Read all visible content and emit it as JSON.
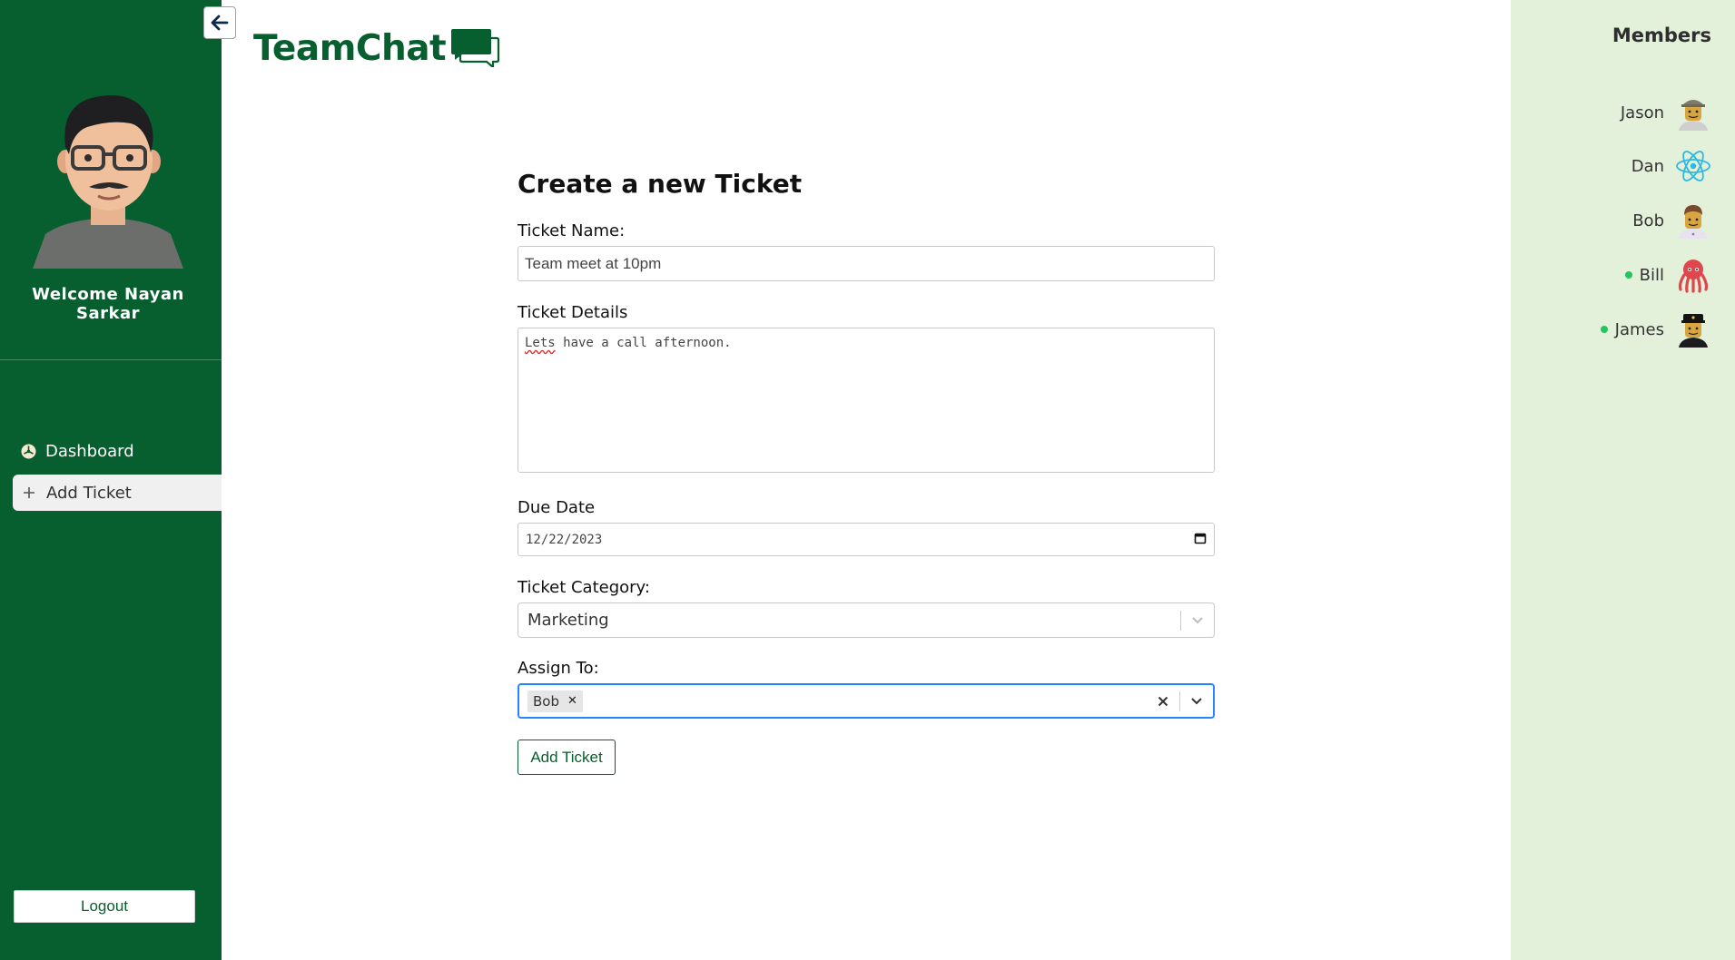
{
  "app": {
    "brand": "TeamChat",
    "back_icon": "arrow-left-icon",
    "brand_color": "#075e2f"
  },
  "sidebar": {
    "welcome": "Welcome Nayan Sarkar",
    "items": [
      {
        "label": "Dashboard",
        "icon": "dashboard-icon",
        "active": false
      },
      {
        "label": "Add Ticket",
        "icon": "plus-icon",
        "active": true
      }
    ],
    "logout_label": "Logout"
  },
  "form": {
    "title": "Create a new Ticket",
    "name_label": "Ticket Name:",
    "name_value": "Team meet at 10pm",
    "details_label": "Ticket Details",
    "details_value_first": "Lets",
    "details_value_rest": " have a call afternoon.",
    "due_label": "Due Date",
    "due_value": "12/22/2023",
    "category_label": "Ticket Category:",
    "category_value": "Marketing",
    "assign_label": "Assign To:",
    "assign_values": [
      "Bob"
    ],
    "submit_label": "Add Ticket"
  },
  "members": {
    "title": "Members",
    "list": [
      {
        "name": "Jason",
        "online": false,
        "avatar": "lego-cap-avatar"
      },
      {
        "name": "Dan",
        "online": false,
        "avatar": "react-logo-avatar"
      },
      {
        "name": "Bob",
        "online": false,
        "avatar": "lego-chef-avatar"
      },
      {
        "name": "Bill",
        "online": true,
        "avatar": "octopus-avatar"
      },
      {
        "name": "James",
        "online": true,
        "avatar": "lego-officer-avatar"
      }
    ],
    "online_color": "#22c55e"
  }
}
